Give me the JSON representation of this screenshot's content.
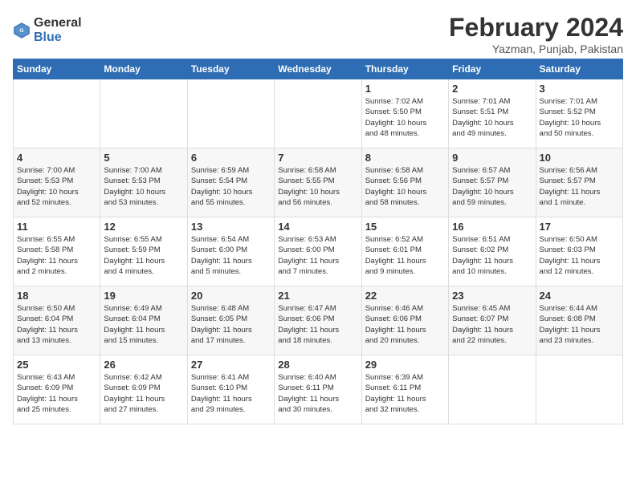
{
  "header": {
    "logo_general": "General",
    "logo_blue": "Blue",
    "month_title": "February 2024",
    "location": "Yazman, Punjab, Pakistan"
  },
  "weekdays": [
    "Sunday",
    "Monday",
    "Tuesday",
    "Wednesday",
    "Thursday",
    "Friday",
    "Saturday"
  ],
  "weeks": [
    [
      {
        "day": "",
        "info": ""
      },
      {
        "day": "",
        "info": ""
      },
      {
        "day": "",
        "info": ""
      },
      {
        "day": "",
        "info": ""
      },
      {
        "day": "1",
        "info": "Sunrise: 7:02 AM\nSunset: 5:50 PM\nDaylight: 10 hours\nand 48 minutes."
      },
      {
        "day": "2",
        "info": "Sunrise: 7:01 AM\nSunset: 5:51 PM\nDaylight: 10 hours\nand 49 minutes."
      },
      {
        "day": "3",
        "info": "Sunrise: 7:01 AM\nSunset: 5:52 PM\nDaylight: 10 hours\nand 50 minutes."
      }
    ],
    [
      {
        "day": "4",
        "info": "Sunrise: 7:00 AM\nSunset: 5:53 PM\nDaylight: 10 hours\nand 52 minutes."
      },
      {
        "day": "5",
        "info": "Sunrise: 7:00 AM\nSunset: 5:53 PM\nDaylight: 10 hours\nand 53 minutes."
      },
      {
        "day": "6",
        "info": "Sunrise: 6:59 AM\nSunset: 5:54 PM\nDaylight: 10 hours\nand 55 minutes."
      },
      {
        "day": "7",
        "info": "Sunrise: 6:58 AM\nSunset: 5:55 PM\nDaylight: 10 hours\nand 56 minutes."
      },
      {
        "day": "8",
        "info": "Sunrise: 6:58 AM\nSunset: 5:56 PM\nDaylight: 10 hours\nand 58 minutes."
      },
      {
        "day": "9",
        "info": "Sunrise: 6:57 AM\nSunset: 5:57 PM\nDaylight: 10 hours\nand 59 minutes."
      },
      {
        "day": "10",
        "info": "Sunrise: 6:56 AM\nSunset: 5:57 PM\nDaylight: 11 hours\nand 1 minute."
      }
    ],
    [
      {
        "day": "11",
        "info": "Sunrise: 6:55 AM\nSunset: 5:58 PM\nDaylight: 11 hours\nand 2 minutes."
      },
      {
        "day": "12",
        "info": "Sunrise: 6:55 AM\nSunset: 5:59 PM\nDaylight: 11 hours\nand 4 minutes."
      },
      {
        "day": "13",
        "info": "Sunrise: 6:54 AM\nSunset: 6:00 PM\nDaylight: 11 hours\nand 5 minutes."
      },
      {
        "day": "14",
        "info": "Sunrise: 6:53 AM\nSunset: 6:00 PM\nDaylight: 11 hours\nand 7 minutes."
      },
      {
        "day": "15",
        "info": "Sunrise: 6:52 AM\nSunset: 6:01 PM\nDaylight: 11 hours\nand 9 minutes."
      },
      {
        "day": "16",
        "info": "Sunrise: 6:51 AM\nSunset: 6:02 PM\nDaylight: 11 hours\nand 10 minutes."
      },
      {
        "day": "17",
        "info": "Sunrise: 6:50 AM\nSunset: 6:03 PM\nDaylight: 11 hours\nand 12 minutes."
      }
    ],
    [
      {
        "day": "18",
        "info": "Sunrise: 6:50 AM\nSunset: 6:04 PM\nDaylight: 11 hours\nand 13 minutes."
      },
      {
        "day": "19",
        "info": "Sunrise: 6:49 AM\nSunset: 6:04 PM\nDaylight: 11 hours\nand 15 minutes."
      },
      {
        "day": "20",
        "info": "Sunrise: 6:48 AM\nSunset: 6:05 PM\nDaylight: 11 hours\nand 17 minutes."
      },
      {
        "day": "21",
        "info": "Sunrise: 6:47 AM\nSunset: 6:06 PM\nDaylight: 11 hours\nand 18 minutes."
      },
      {
        "day": "22",
        "info": "Sunrise: 6:46 AM\nSunset: 6:06 PM\nDaylight: 11 hours\nand 20 minutes."
      },
      {
        "day": "23",
        "info": "Sunrise: 6:45 AM\nSunset: 6:07 PM\nDaylight: 11 hours\nand 22 minutes."
      },
      {
        "day": "24",
        "info": "Sunrise: 6:44 AM\nSunset: 6:08 PM\nDaylight: 11 hours\nand 23 minutes."
      }
    ],
    [
      {
        "day": "25",
        "info": "Sunrise: 6:43 AM\nSunset: 6:09 PM\nDaylight: 11 hours\nand 25 minutes."
      },
      {
        "day": "26",
        "info": "Sunrise: 6:42 AM\nSunset: 6:09 PM\nDaylight: 11 hours\nand 27 minutes."
      },
      {
        "day": "27",
        "info": "Sunrise: 6:41 AM\nSunset: 6:10 PM\nDaylight: 11 hours\nand 29 minutes."
      },
      {
        "day": "28",
        "info": "Sunrise: 6:40 AM\nSunset: 6:11 PM\nDaylight: 11 hours\nand 30 minutes."
      },
      {
        "day": "29",
        "info": "Sunrise: 6:39 AM\nSunset: 6:11 PM\nDaylight: 11 hours\nand 32 minutes."
      },
      {
        "day": "",
        "info": ""
      },
      {
        "day": "",
        "info": ""
      }
    ]
  ]
}
